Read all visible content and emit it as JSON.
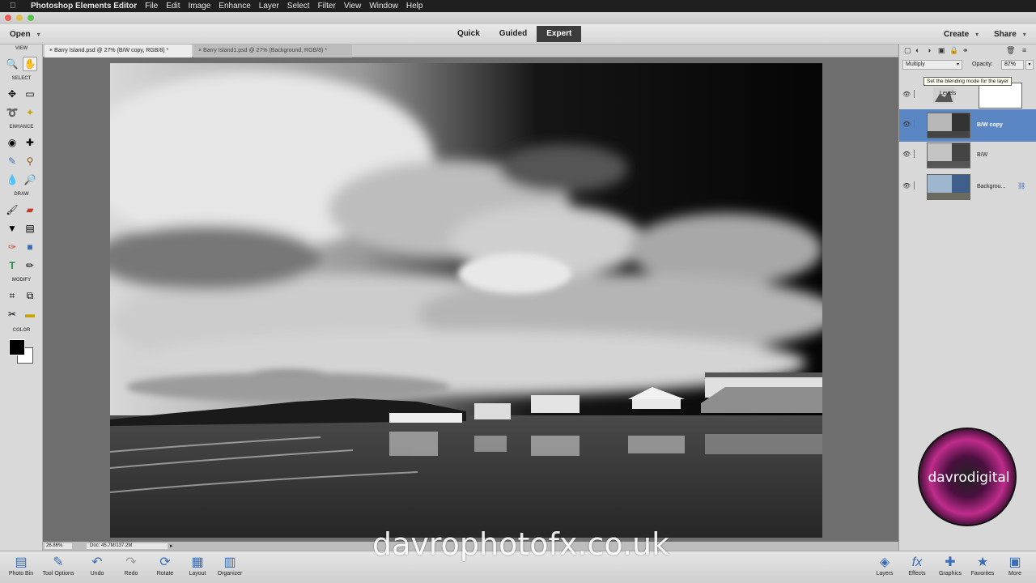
{
  "menubar": {
    "app_name": "Photoshop Elements Editor",
    "items": [
      "File",
      "Edit",
      "Image",
      "Enhance",
      "Layer",
      "Select",
      "Filter",
      "View",
      "Window",
      "Help"
    ]
  },
  "modebar": {
    "open": "Open",
    "modes": [
      "Quick",
      "Guided",
      "Expert"
    ],
    "active_mode": "Expert",
    "create": "Create",
    "share": "Share"
  },
  "toolbox": {
    "sections": [
      "VIEW",
      "SELECT",
      "ENHANCE",
      "DRAW",
      "MODIFY",
      "COLOR"
    ]
  },
  "tabs": [
    "Barry Island.psd @ 27% (B/W copy, RGB/8) *",
    "Barry Island1.psd @ 27% (Background, RGB/8) *"
  ],
  "status": {
    "zoom": "26.86%",
    "doc": "Doc: 45.7M/137.2M"
  },
  "layers_panel": {
    "blend_mode": "Multiply",
    "opacity_label": "Opacity:",
    "opacity_value": "87%",
    "tooltip": "Set the blending mode for the layer",
    "layers": [
      {
        "name": "Levels",
        "selected": false
      },
      {
        "name": "B/W copy",
        "selected": true
      },
      {
        "name": "B/W",
        "selected": false
      },
      {
        "name": "Backgrou...",
        "selected": false
      }
    ]
  },
  "logo_text": "davrodigital",
  "watermark": "davrophotofx.co.uk",
  "bottombar": {
    "left": [
      "Photo Bin",
      "Tool Options",
      "Undo",
      "Redo",
      "Rotate",
      "Layout",
      "Organizer"
    ],
    "right": [
      "Layers",
      "Effects",
      "Graphics",
      "Favorites",
      "More"
    ]
  },
  "colors": {
    "accent": "#5b86c4",
    "active_mode_bg": "#3c3c3c",
    "foreground": "#000000",
    "background": "#ffffff"
  }
}
